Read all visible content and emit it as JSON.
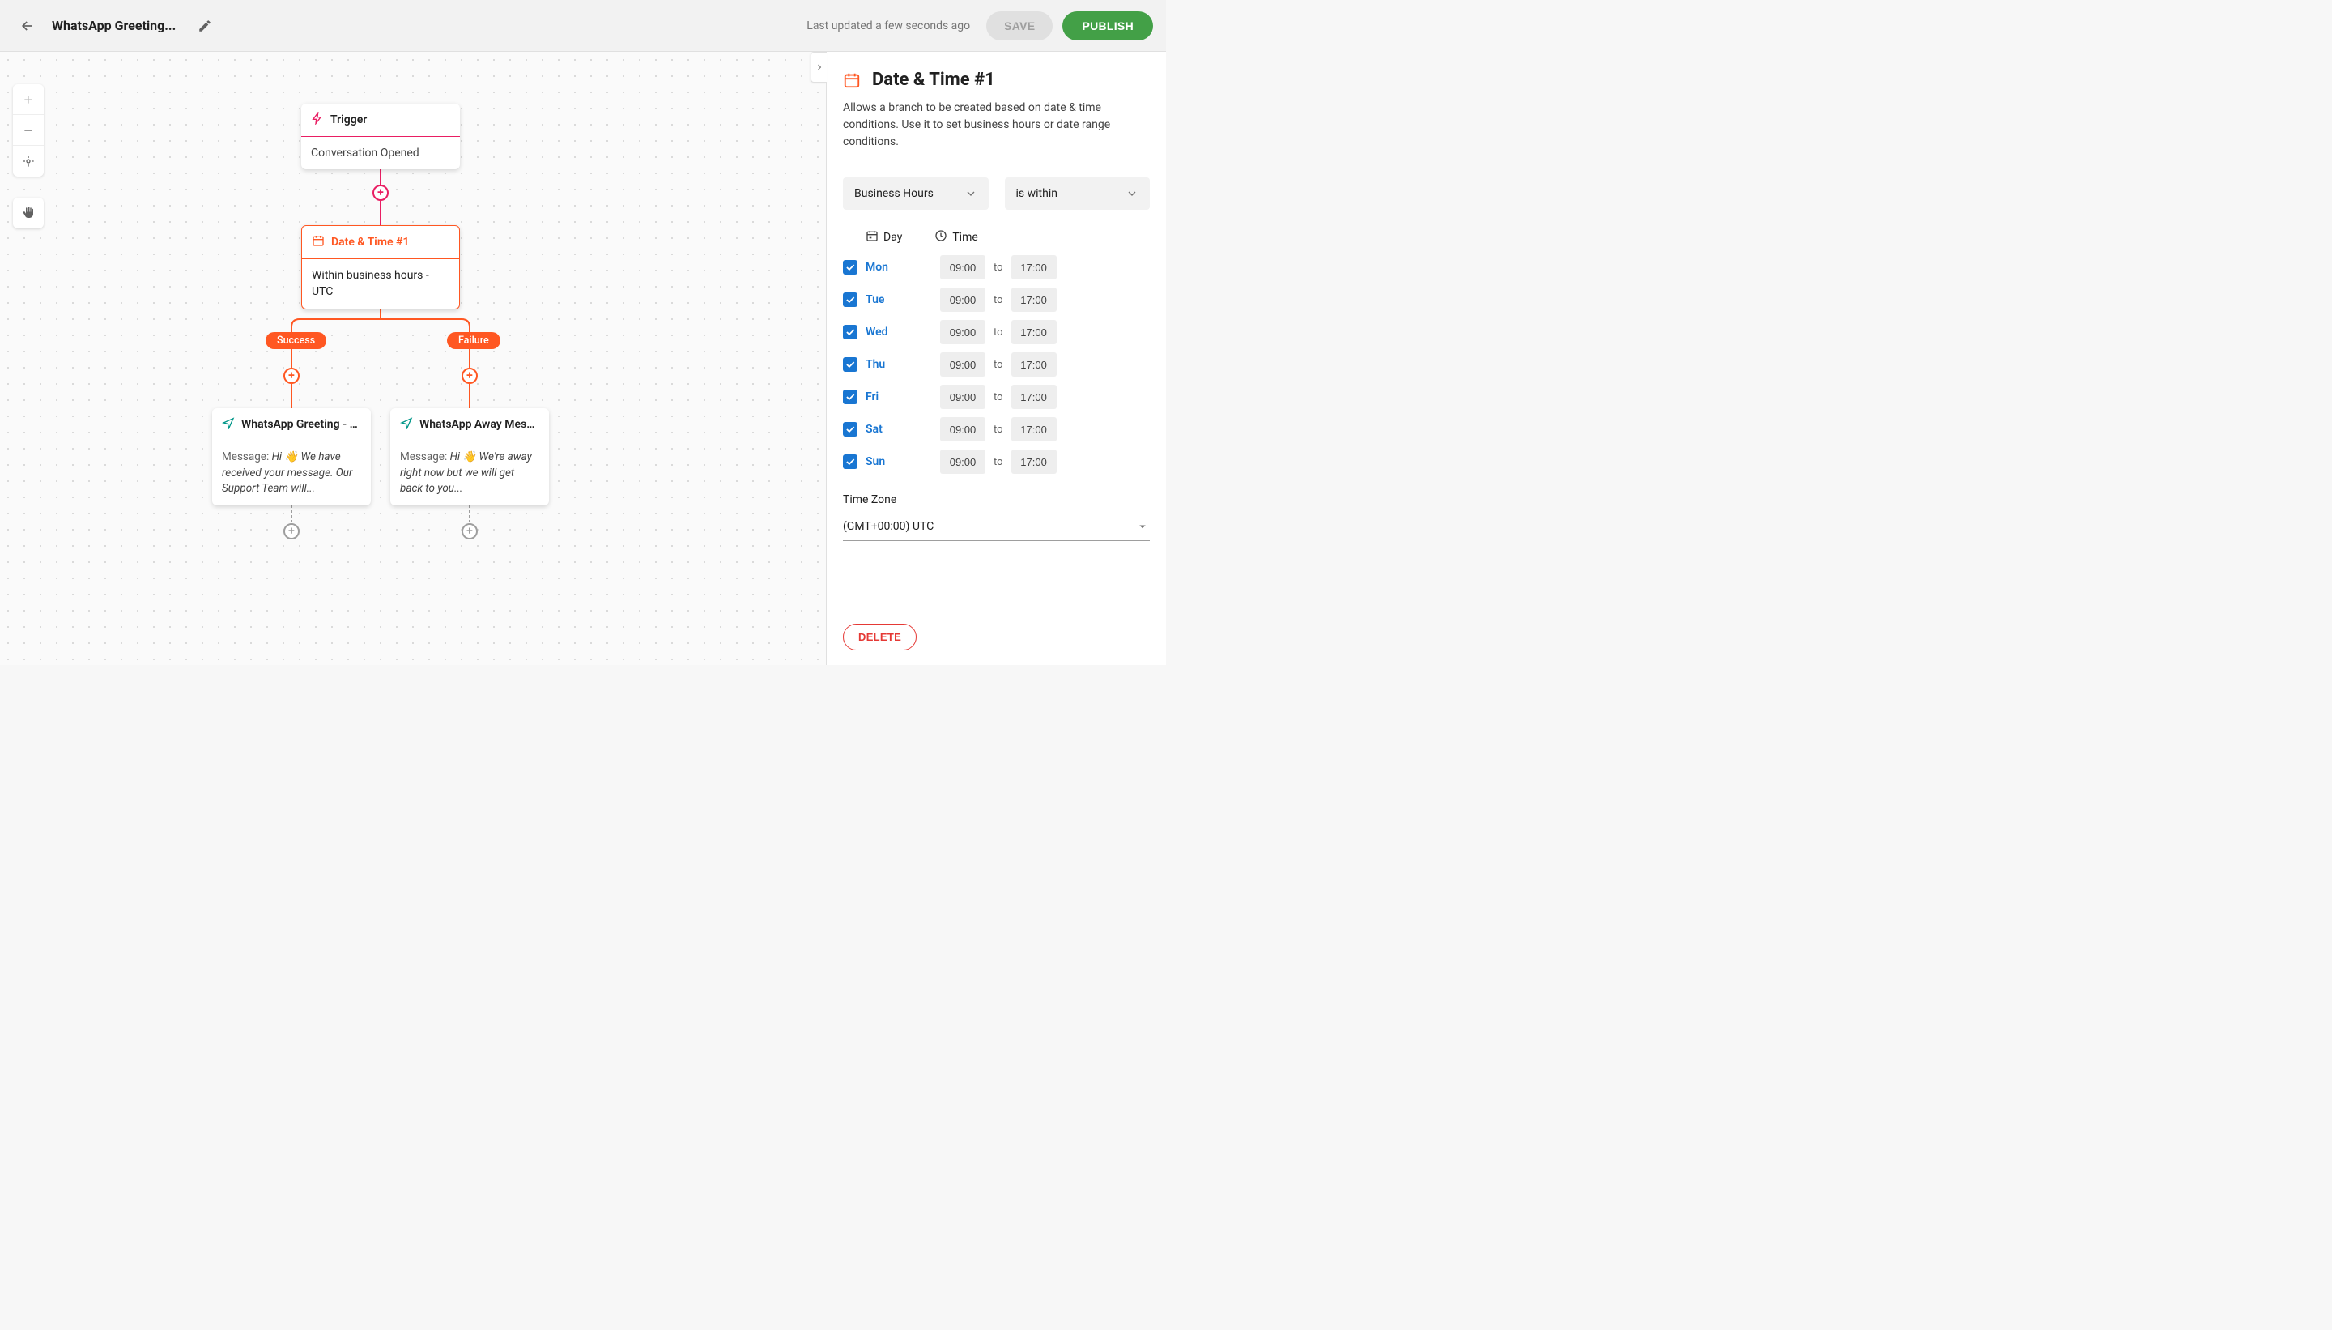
{
  "header": {
    "title": "WhatsApp Greeting...",
    "last_updated": "Last updated a few seconds ago",
    "save_label": "SAVE",
    "publish_label": "PUBLISH"
  },
  "canvas": {
    "trigger": {
      "label": "Trigger",
      "body": "Conversation Opened"
    },
    "datetime": {
      "label": "Date & Time #1",
      "body": "Within business hours - UTC"
    },
    "branches": {
      "success": "Success",
      "failure": "Failure"
    },
    "send_greeting": {
      "label": "WhatsApp Greeting - Ge…",
      "msg_prefix": "Message: ",
      "msg_text": "Hi 👋 We have received your message. Our Support Team will..."
    },
    "send_away": {
      "label": "WhatsApp Away Message",
      "msg_prefix": "Message: ",
      "msg_text": "Hi 👋 We're away right now but we will get back to you..."
    }
  },
  "panel": {
    "title": "Date & Time #1",
    "description": "Allows a branch to be created based on date & time conditions. Use it to set business hours or date range conditions.",
    "mode": "Business Hours",
    "operator": "is within",
    "day_header": "Day",
    "time_header": "Time",
    "to_label": "to",
    "days": [
      {
        "name": "Mon",
        "from": "09:00",
        "to": "17:00"
      },
      {
        "name": "Tue",
        "from": "09:00",
        "to": "17:00"
      },
      {
        "name": "Wed",
        "from": "09:00",
        "to": "17:00"
      },
      {
        "name": "Thu",
        "from": "09:00",
        "to": "17:00"
      },
      {
        "name": "Fri",
        "from": "09:00",
        "to": "17:00"
      },
      {
        "name": "Sat",
        "from": "09:00",
        "to": "17:00"
      },
      {
        "name": "Sun",
        "from": "09:00",
        "to": "17:00"
      }
    ],
    "timezone_label": "Time Zone",
    "timezone_value": "(GMT+00:00) UTC",
    "delete_label": "DELETE"
  }
}
